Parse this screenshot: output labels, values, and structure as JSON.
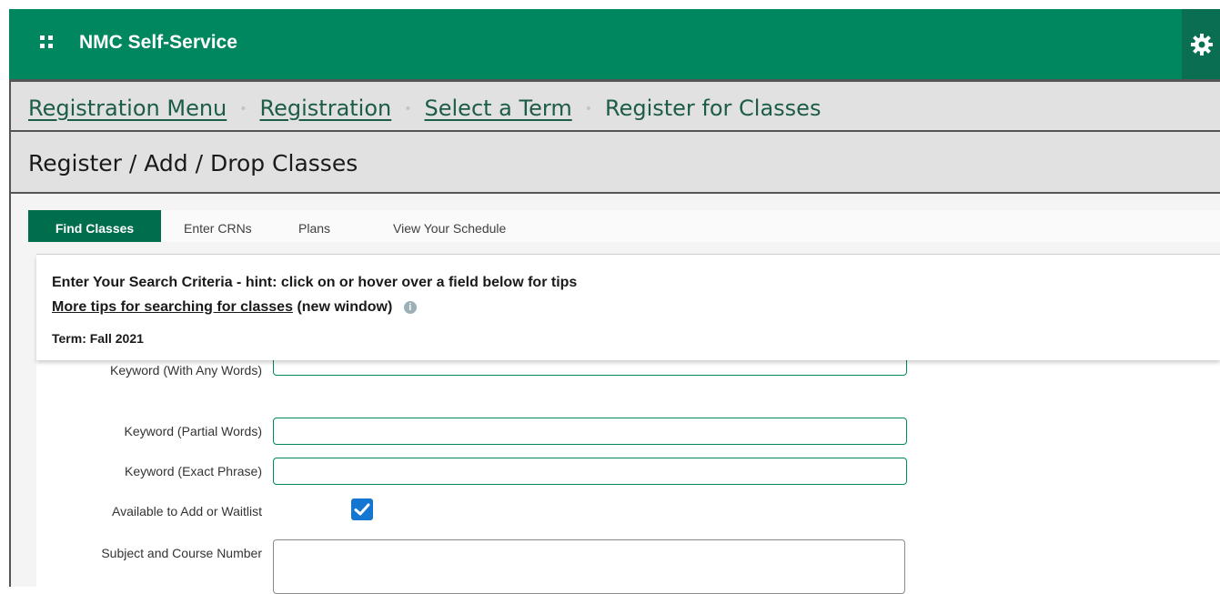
{
  "app": {
    "title": "NMC Self-Service",
    "brand_color": "#00875f"
  },
  "breadcrumb": {
    "items": [
      "Registration Menu",
      "Registration",
      "Select a Term"
    ],
    "current": "Register for Classes",
    "separator": "•"
  },
  "page": {
    "title": "Register / Add / Drop Classes"
  },
  "tabs": [
    {
      "label": "Find Classes",
      "active": true
    },
    {
      "label": "Enter CRNs",
      "active": false
    },
    {
      "label": "Plans",
      "active": false
    },
    {
      "label": "View Your Schedule",
      "active": false
    }
  ],
  "search": {
    "hint": "Enter Your Search Criteria - hint: click on or hover over a field below for tips",
    "tips_link": "More tips for searching for classes",
    "tips_suffix": "(new window)",
    "info_icon": "info-icon",
    "term": "Term: Fall 2021"
  },
  "fields": {
    "keyword_any": {
      "label": "Keyword (With Any Words)",
      "value": ""
    },
    "keyword_partial": {
      "label": "Keyword (Partial Words)",
      "value": ""
    },
    "keyword_exact": {
      "label": "Keyword (Exact Phrase)",
      "value": ""
    },
    "available": {
      "label": "Available to Add or Waitlist",
      "checked": true
    },
    "subject": {
      "label": "Subject and Course Number",
      "value": ""
    }
  }
}
